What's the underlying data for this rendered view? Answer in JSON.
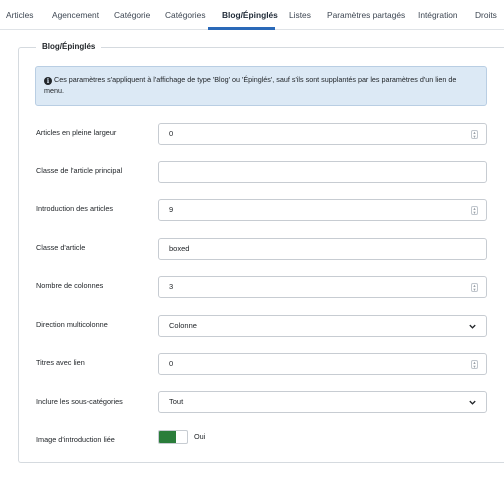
{
  "tabs": [
    "Articles",
    "Agencement",
    "Catégorie",
    "Catégories",
    "Blog/Épinglés",
    "Listes",
    "Paramètres partagés",
    "Intégration",
    "Droits"
  ],
  "active_tab": "Blog/Épinglés",
  "section": {
    "legend": "Blog/Épinglés",
    "alert_text": "Ces paramètres s'appliquent à l'affichage de type 'Blog' ou 'Épinglés', sauf s'ils sont supplantés par les paramètres d'un lien de menu."
  },
  "fields": {
    "leading_full_width": {
      "label": "Articles en pleine largeur",
      "value": "0"
    },
    "lead_class": {
      "label": "Classe de l'article principal",
      "value": ""
    },
    "intro_articles": {
      "label": "Introduction des articles",
      "value": "9"
    },
    "article_class": {
      "label": "Classe d'article",
      "value": "boxed"
    },
    "columns": {
      "label": "Nombre de colonnes",
      "value": "3"
    },
    "multicolumn_direction": {
      "label": "Direction multicolonne",
      "value": "Colonne"
    },
    "linked_titles": {
      "label": "Titres avec lien",
      "value": "0"
    },
    "subcategories": {
      "label": "Inclure les sous-catégories",
      "value": "Tout"
    },
    "linked_intro_image": {
      "label": "Image d'introduction liée",
      "value": "Oui"
    }
  },
  "colors": {
    "accent": "#2a69b8",
    "toggle_on": "#2a7d3a",
    "alert_bg": "#dce9f5"
  },
  "icons": [
    "info-icon",
    "spinner-icon",
    "chevron-down-icon"
  ]
}
